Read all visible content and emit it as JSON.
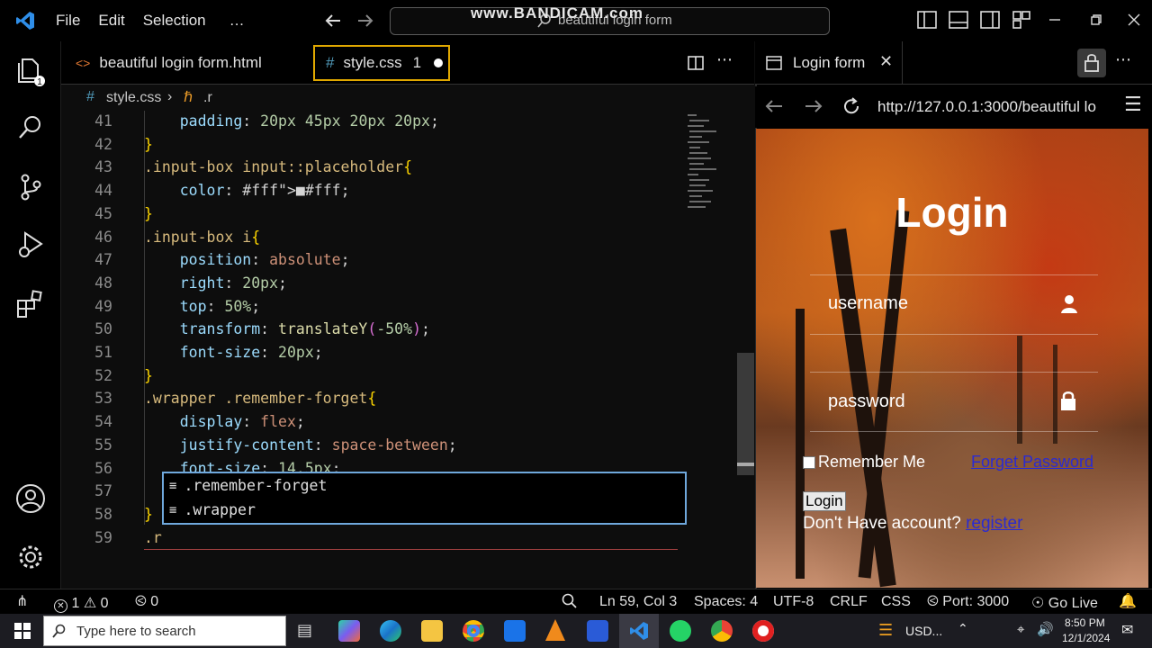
{
  "overlay": {
    "watermark": "www.BANDICAM.com"
  },
  "titlebar": {
    "menus": [
      "File",
      "Edit",
      "Selection",
      "…"
    ],
    "search_text": "beautiful login form"
  },
  "editor": {
    "tabs": [
      {
        "label": "beautiful login form.html",
        "active": false
      },
      {
        "label": "style.css",
        "active": true,
        "problems": "1"
      }
    ],
    "breadcrumb": {
      "file": "style.css",
      "symbol": ".r"
    },
    "lines": [
      {
        "n": "41",
        "text": "    padding: 20px 45px 20px 20px;"
      },
      {
        "n": "42",
        "text": "}"
      },
      {
        "n": "43",
        "text": ".input-box input::placeholder{"
      },
      {
        "n": "44",
        "text": "    color: ■#fff;"
      },
      {
        "n": "45",
        "text": "}"
      },
      {
        "n": "46",
        "text": ".input-box i{"
      },
      {
        "n": "47",
        "text": "    position: absolute;"
      },
      {
        "n": "48",
        "text": "    right: 20px;"
      },
      {
        "n": "49",
        "text": "    top: 50%;"
      },
      {
        "n": "50",
        "text": "    transform: translateY(-50%);"
      },
      {
        "n": "51",
        "text": "    font-size: 20px;"
      },
      {
        "n": "52",
        "text": "}"
      },
      {
        "n": "53",
        "text": ".wrapper .remember-forget{"
      },
      {
        "n": "54",
        "text": "    display: flex;"
      },
      {
        "n": "55",
        "text": "    justify-content: space-between;"
      },
      {
        "n": "56",
        "text": "    font-size: 14.5px;"
      },
      {
        "n": "57",
        "text": ""
      },
      {
        "n": "58",
        "text": "}"
      },
      {
        "n": "59",
        "text": ".r"
      }
    ],
    "suggestions": [
      ".remember-forget",
      ".wrapper"
    ]
  },
  "browser": {
    "tab_title": "Login form",
    "url": "http://127.0.0.1:3000/beautiful lo",
    "page": {
      "title": "Login",
      "username_placeholder": "username",
      "password_placeholder": "password",
      "remember_label": "Remember Me",
      "forget_link": "Forget Password",
      "login_button": "Login",
      "no_account": "Don't Have account?",
      "register_link": "register"
    }
  },
  "statusbar": {
    "errors": "1",
    "warnings": "0",
    "ports": "0",
    "position": "Ln 59, Col 3",
    "spaces": "Spaces: 4",
    "encoding": "UTF-8",
    "eol": "CRLF",
    "language": "CSS",
    "port": "Port: 3000",
    "golive": "Go Live"
  },
  "taskbar": {
    "search_placeholder": "Type here to search",
    "currency": "USD...",
    "time": "8:50 PM",
    "date": "12/1/2024"
  },
  "colors": {
    "accent": "#6fa8dc",
    "vscode_blue": "#2f8ee8",
    "link": "#2b2bd0"
  }
}
